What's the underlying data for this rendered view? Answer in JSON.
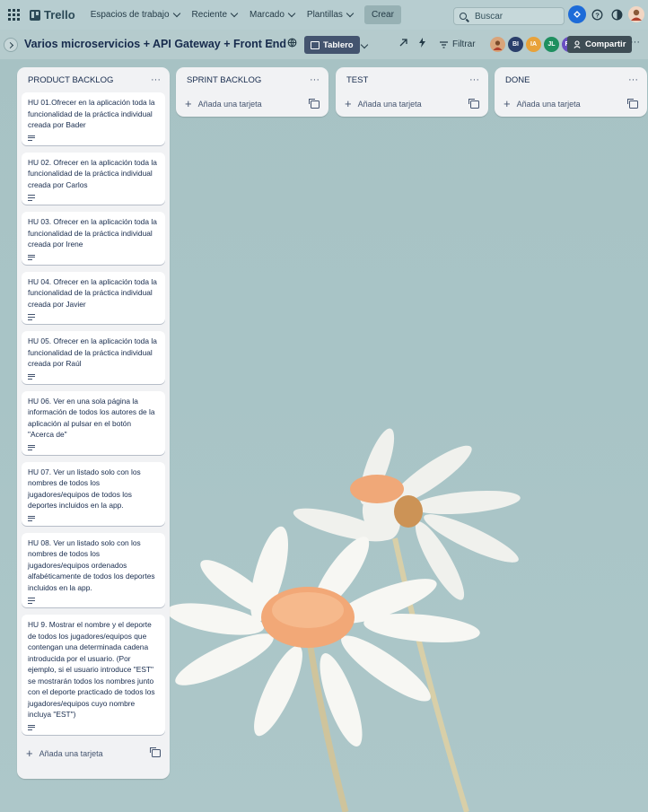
{
  "topnav": {
    "brand": "Trello",
    "menu": [
      {
        "label": "Espacios de trabajo"
      },
      {
        "label": "Reciente"
      },
      {
        "label": "Marcado"
      },
      {
        "label": "Plantillas"
      }
    ],
    "create_label": "Crear",
    "search_placeholder": "Buscar"
  },
  "board": {
    "title": "Varios microservicios + API Gateway + Front End",
    "view_label": "Tablero",
    "filter_label": "Filtrar",
    "share_label": "Compartir",
    "members": [
      {
        "initials": "",
        "color": "#c98a5a"
      },
      {
        "initials": "BI",
        "color": "#2b3f6b"
      },
      {
        "initials": "IA",
        "color": "#e8a23a"
      },
      {
        "initials": "JL",
        "color": "#1f8f5f"
      },
      {
        "initials": "RC",
        "color": "#6a4fc2"
      }
    ]
  },
  "lists": [
    {
      "title": "PRODUCT BACKLOG",
      "add_label": "Añada una tarjeta",
      "cards": [
        {
          "text": "HU 01.Ofrecer en la aplicación toda la funcionalidad de la práctica individual creada por Bader"
        },
        {
          "text": "HU 02. Ofrecer en la aplicación toda la funcionalidad de la práctica individual creada por Carlos"
        },
        {
          "text": "HU 03. Ofrecer en la aplicación toda la funcionalidad de la práctica individual creada por Irene"
        },
        {
          "text": "HU 04. Ofrecer en la aplicación toda la funcionalidad de la práctica individual creada por Javier"
        },
        {
          "text": "HU 05. Ofrecer en la aplicación toda la funcionalidad de la práctica individual creada por Raúl"
        },
        {
          "text": "HU 06. Ver en una sola página la información de todos los autores de la aplicación al pulsar en el botón \"Acerca de\""
        },
        {
          "text": "HU 07. Ver un listado solo con los nombres de todos los jugadores/equipos de todos los deportes incluidos en la app."
        },
        {
          "text": "HU 08. Ver un listado solo con los nombres de todos los jugadores/equipos ordenados alfabéticamente de todos los deportes incluidos en la app."
        },
        {
          "text": "HU 9. Mostrar el nombre y el deporte de todos los jugadores/equipos que contengan una determinada cadena introducida por el usuario. (Por ejemplo, si el usuario introduce \"EST\" se mostrarán todos los nombres junto con el deporte practicado de todos los jugadores/equipos cuyo nombre incluya \"EST\")"
        }
      ]
    },
    {
      "title": "SPRINT BACKLOG",
      "add_label": "Añada una tarjeta",
      "cards": []
    },
    {
      "title": "TEST",
      "add_label": "Añada una tarjeta",
      "cards": []
    },
    {
      "title": "DONE",
      "add_label": "Añada una tarjeta",
      "cards": []
    }
  ]
}
